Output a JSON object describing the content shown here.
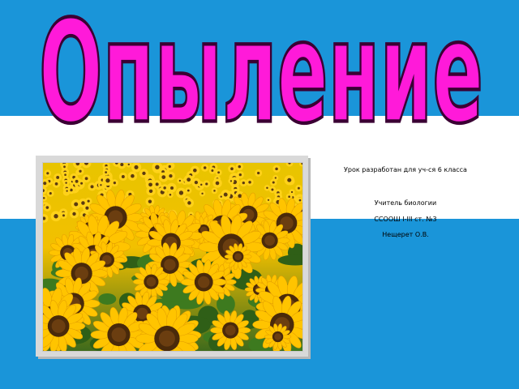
{
  "slide": {
    "title": "Опыление",
    "image_description_name": "sunflower-field-image",
    "info": {
      "line1": "Урок разработан для уч-ся 6 класса",
      "line2": "Учитель биологии",
      "line3": "ССООШ I-III ст. №3",
      "line4": "Нещерет О.В."
    }
  },
  "colors": {
    "background_blue": "#1a95d9",
    "band_white": "#ffffff",
    "title_fill": "#ff1ad9",
    "title_stroke": "#3a0033"
  }
}
